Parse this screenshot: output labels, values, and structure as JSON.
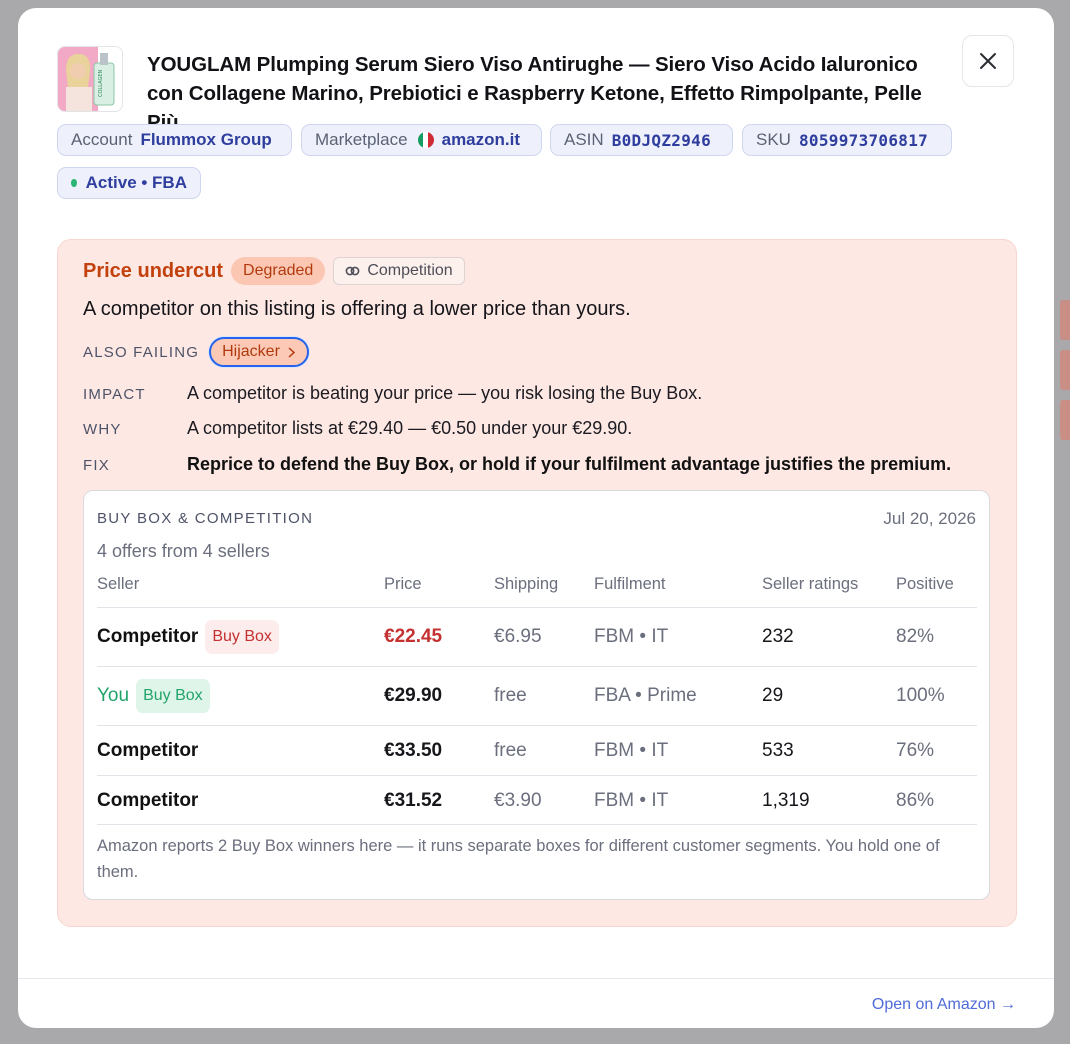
{
  "product": {
    "title": "YOUGLAM Plumping Serum Siero Viso Antirughe — Siero Viso Acido Ialuronico con Collagene Marino, Prebiotici e Raspberry Ketone, Effetto Rimpolpante, Pelle Più...",
    "thumb_text": "COLLAGEN"
  },
  "chips": {
    "account_label": "Account",
    "account_value": "Flummox Group",
    "marketplace_label": "Marketplace",
    "marketplace_value": "amazon.it",
    "asin_label": "ASIN",
    "asin_value": "B0DJQZ2946",
    "sku_label": "SKU",
    "sku_value": "8059973706817",
    "status": "Active • FBA"
  },
  "alert": {
    "title": "Price undercut",
    "severity": "Degraded",
    "category": "Competition",
    "summary": "A competitor on this listing is offering a lower price than yours.",
    "also_failing_label": "ALSO FAILING",
    "also_failing_item": "Hijacker",
    "impact_label": "IMPACT",
    "impact": "A competitor is beating your price — you risk losing the Buy Box.",
    "why_label": "WHY",
    "why": "A competitor lists at €29.40 — €0.50 under your €29.90.",
    "fix_label": "FIX",
    "fix": "Reprice to defend the Buy Box, or hold if your fulfilment advantage justifies the premium."
  },
  "competition": {
    "title": "BUY BOX & COMPETITION",
    "date": "Jul 20, 2026",
    "subtitle": "4 offers from 4 sellers",
    "columns": [
      "Seller",
      "Price",
      "Shipping",
      "Fulfilment",
      "Seller ratings",
      "Positive"
    ],
    "rows": [
      {
        "seller": "Competitor",
        "badge": "Buy Box",
        "price": "€22.45",
        "shipping": "€6.95",
        "fulfilment": "FBM • IT",
        "ratings": "232",
        "positive": "82%"
      },
      {
        "seller": "You",
        "badge": "Buy Box",
        "price": "€29.90",
        "shipping": "free",
        "fulfilment": "FBA • Prime",
        "ratings": "29",
        "positive": "100%"
      },
      {
        "seller": "Competitor",
        "badge": "",
        "price": "€33.50",
        "shipping": "free",
        "fulfilment": "FBM • IT",
        "ratings": "533",
        "positive": "76%"
      },
      {
        "seller": "Competitor",
        "badge": "",
        "price": "€31.52",
        "shipping": "€3.90",
        "fulfilment": "FBM • IT",
        "ratings": "1,319",
        "positive": "86%"
      }
    ],
    "note": "Amazon reports 2 Buy Box winners here — it runs separate boxes for different customer segments. You hold one of them."
  },
  "footer": {
    "open_link": "Open on Amazon →"
  },
  "colors": {
    "accent": "#2f3e9e",
    "alert_bg": "#fde8e4",
    "alert_title": "#c2410c",
    "buybox_red": "#c53030",
    "buybox_green": "#22a36a",
    "link": "#4f6bd8"
  }
}
